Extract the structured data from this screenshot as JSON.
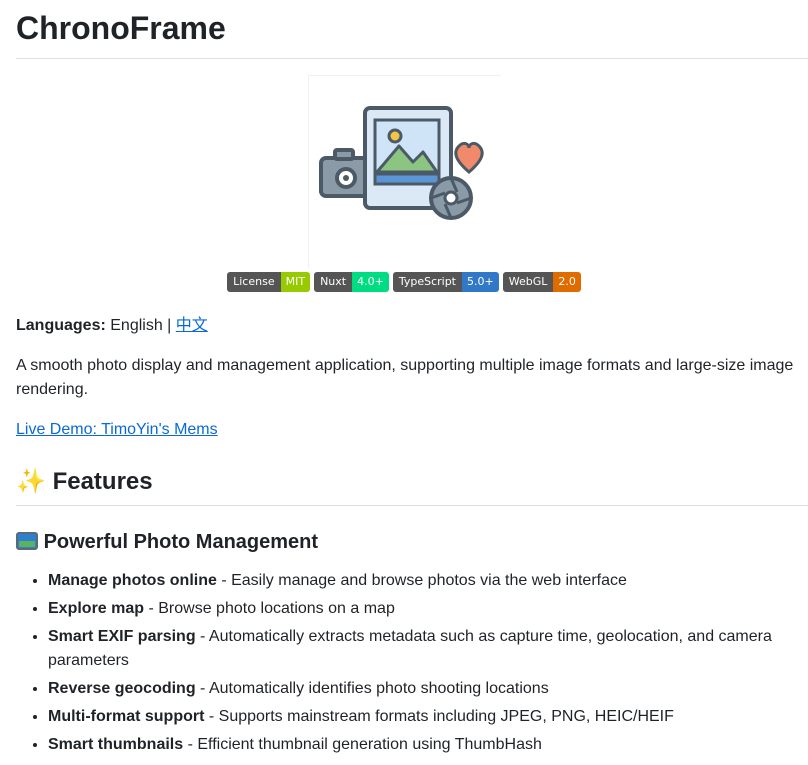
{
  "title": "ChronoFrame",
  "badges": [
    {
      "label": "License",
      "value": "MIT",
      "color": "#97ca00"
    },
    {
      "label": "Nuxt",
      "value": "4.0+",
      "color": "#00dc82"
    },
    {
      "label": "TypeScript",
      "value": "5.0+",
      "color": "#3178c6"
    },
    {
      "label": "WebGL",
      "value": "2.0",
      "color": "#e06c00"
    }
  ],
  "languages": {
    "label": "Languages:",
    "current": "English |",
    "alt_link": "中文"
  },
  "description": "A smooth photo display and management application, supporting multiple image formats and large-size image rendering.",
  "demo_link": "Live Demo: TimoYin's Mems",
  "features_heading": "Features",
  "photo_mgmt_heading": "Powerful Photo Management",
  "features": [
    {
      "bold": "Manage photos online",
      "text": " - Easily manage and browse photos via the web interface"
    },
    {
      "bold": "Explore map",
      "text": " - Browse photo locations on a map"
    },
    {
      "bold": "Smart EXIF parsing",
      "text": " - Automatically extracts metadata such as capture time, geolocation, and camera parameters"
    },
    {
      "bold": "Reverse geocoding",
      "text": " - Automatically identifies photo shooting locations"
    },
    {
      "bold": "Multi-format support",
      "text": " - Supports mainstream formats including JPEG, PNG, HEIC/HEIF"
    },
    {
      "bold": "Smart thumbnails",
      "text": " - Efficient thumbnail generation using ThumbHash"
    }
  ],
  "icons": {
    "logo": "photo-frame-logo-icon",
    "features_emoji": "sparkles-icon",
    "photo_emoji": "framed-picture-icon"
  }
}
